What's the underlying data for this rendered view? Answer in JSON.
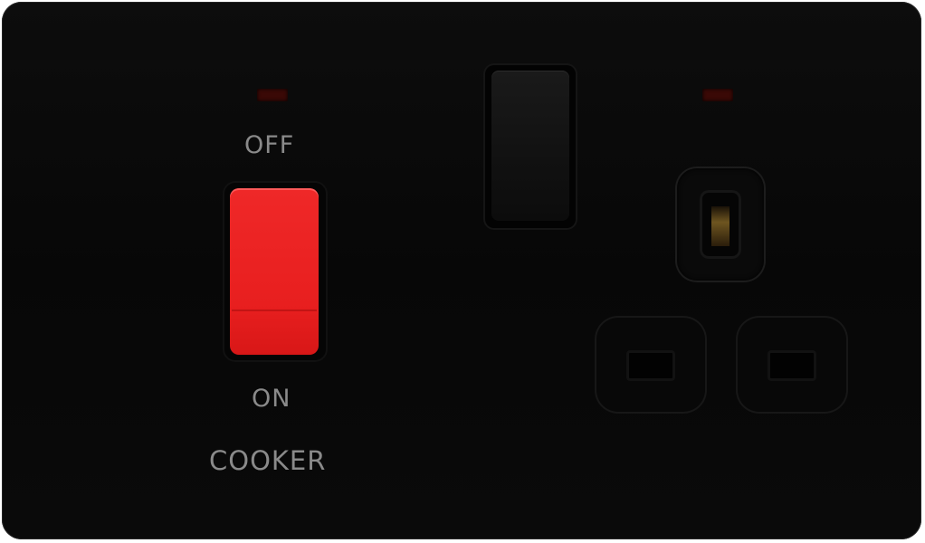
{
  "switch_plate": {
    "finish_color": "#0a0a0a",
    "left_indicator": {
      "state": "off",
      "color": "#3a0906"
    },
    "right_indicator": {
      "state": "off",
      "color": "#3a0906"
    },
    "cooker_switch": {
      "off_label": "OFF",
      "on_label": "ON",
      "name_label": "COOKER",
      "rocker_color": "#e81f1f"
    },
    "socket": {
      "rocker_color": "#111111",
      "earth_pin_icon": "earth-pin-icon",
      "live_pin_icon": "pin-hole-icon",
      "neutral_pin_icon": "pin-hole-icon"
    }
  }
}
